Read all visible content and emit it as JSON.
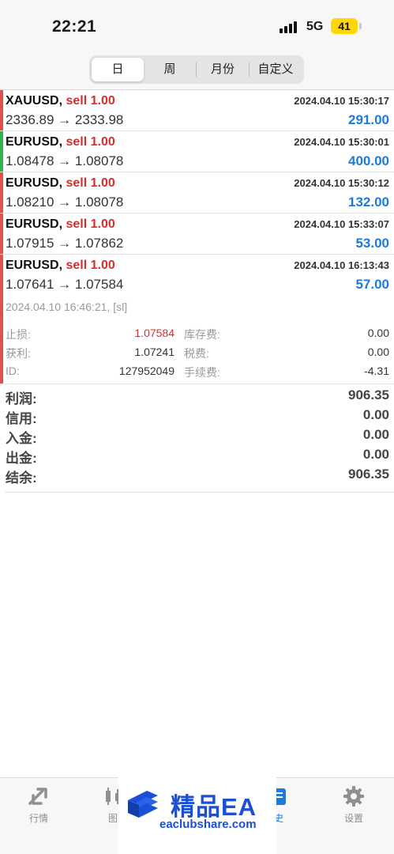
{
  "status_bar": {
    "time": "22:21",
    "network": "5G",
    "battery": "41"
  },
  "period_tabs": [
    {
      "label": "日",
      "active": true
    },
    {
      "label": "周",
      "active": false
    },
    {
      "label": "月份",
      "active": false
    },
    {
      "label": "自定义",
      "active": false
    }
  ],
  "trades": [
    {
      "symbol": "XAUUSD,",
      "side": "sell 1.00",
      "time": "2024.04.10 15:30:17",
      "prices": "2336.89 → 2333.98",
      "profit": "291.00",
      "edge_color": "#e0504c"
    },
    {
      "symbol": "EURUSD,",
      "side": "sell 1.00",
      "time": "2024.04.10 15:30:01",
      "prices": "1.08478 → 1.08078",
      "profit": "400.00",
      "edge_color": "#2fb34a"
    },
    {
      "symbol": "EURUSD,",
      "side": "sell 1.00",
      "time": "2024.04.10 15:30:12",
      "prices": "1.08210 → 1.08078",
      "profit": "132.00",
      "edge_color": "#e0504c"
    },
    {
      "symbol": "EURUSD,",
      "side": "sell 1.00",
      "time": "2024.04.10 15:33:07",
      "prices": "1.07915 → 1.07862",
      "profit": "53.00",
      "edge_color": "#e0504c"
    },
    {
      "symbol": "EURUSD,",
      "side": "sell 1.00",
      "time": "2024.04.10 16:13:43",
      "prices": "1.07641 → 1.07584",
      "profit": "57.00",
      "edge_color": "#e0504c"
    }
  ],
  "detail": {
    "close_stamp": "2024.04.10 16:46:21, [sl]",
    "rows": [
      {
        "label": "止损:",
        "value": "1.07584",
        "label2": "库存费:",
        "value2": "0.00"
      },
      {
        "label": "获利:",
        "value": "1.07241",
        "label2": "税费:",
        "value2": "0.00"
      },
      {
        "label": "ID:",
        "value": "127952049",
        "label2": "手续费:",
        "value2": "-4.31"
      }
    ]
  },
  "summary": [
    {
      "label": "利润:",
      "value": "906.35"
    },
    {
      "label": "信用:",
      "value": "0.00"
    },
    {
      "label": "入金:",
      "value": "0.00"
    },
    {
      "label": "出金:",
      "value": "0.00"
    },
    {
      "label": "结余:",
      "value": "906.35"
    }
  ],
  "tabbar": {
    "quotes": "行情",
    "chart": "图",
    "history": "史",
    "settings": "设置"
  },
  "watermark": {
    "title": "精品EA",
    "url": "eaclubshare.com"
  },
  "colors": {
    "sell": "#d2302f",
    "profit": "#1e7ad6",
    "accent": "#1e7ad6",
    "watermark": "#1a4fd6"
  }
}
